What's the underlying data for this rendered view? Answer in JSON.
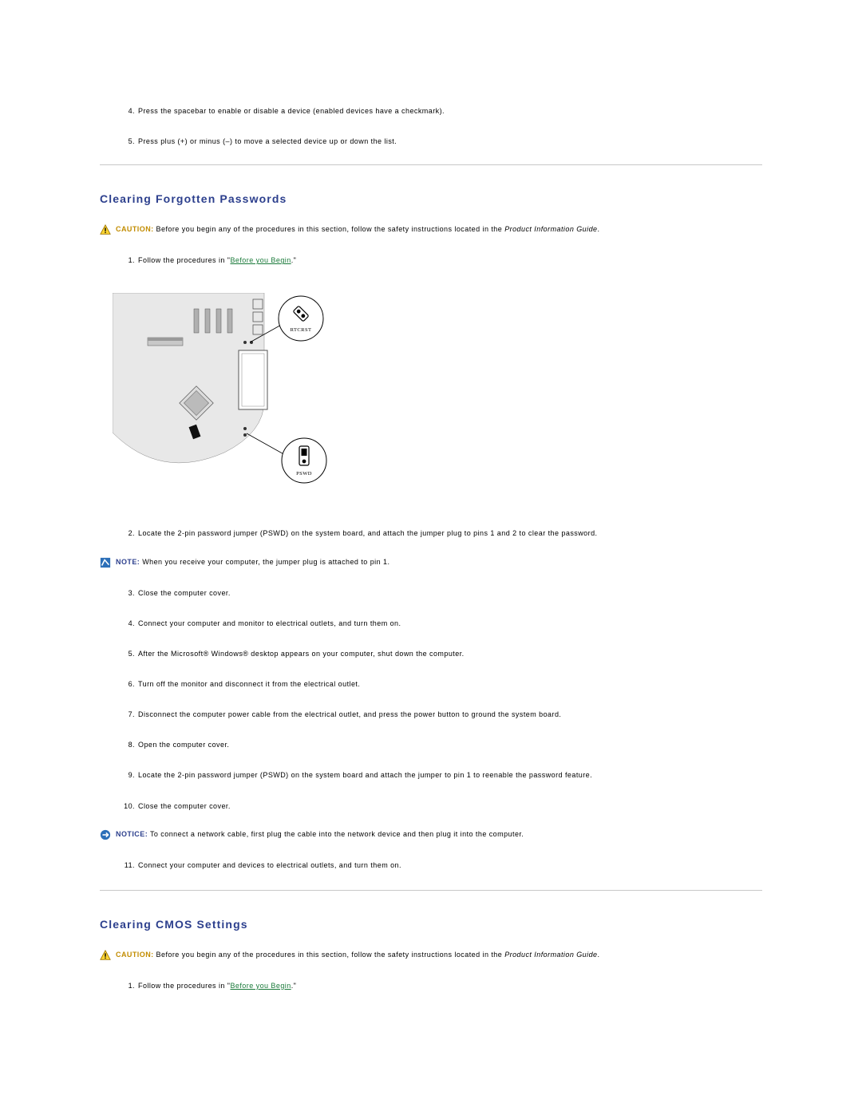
{
  "top_steps": [
    {
      "n": "4.",
      "t": "Press the spacebar to enable or disable a device (enabled devices have a checkmark)."
    },
    {
      "n": "5.",
      "t": "Press plus (+) or minus (–) to move a selected device up or down the list."
    }
  ],
  "section1": {
    "heading": "Clearing Forgotten Passwords",
    "caution_label": "CAUTION:",
    "caution_text_a": "Before you begin any of the procedures in this section, follow the safety instructions located in the ",
    "caution_text_b": "Product Information Guide",
    "caution_text_c": ".",
    "step1_pre": "Follow the procedures in \"",
    "step1_link": "Before you Begin",
    "step1_post": ".\"",
    "diagram": {
      "label_rtcrst": "RTCRST",
      "label_pswd": "PSWD"
    },
    "step2": "Locate the 2-pin password jumper (PSWD) on the system board, and attach the jumper plug to pins 1 and 2 to clear the password.",
    "note_label": "NOTE:",
    "note_text": "When you receive your computer, the jumper plug is attached to pin 1.",
    "steps_3_11": [
      {
        "n": "3.",
        "t": "Close the computer cover."
      },
      {
        "n": "4.",
        "t": "Connect your computer and monitor to electrical outlets, and turn them on."
      },
      {
        "n": "5.",
        "t": "After the Microsoft® Windows® desktop appears on your computer, shut down the computer."
      },
      {
        "n": "6.",
        "t": "Turn off the monitor and disconnect it from the electrical outlet."
      },
      {
        "n": "7.",
        "t": "Disconnect the computer power cable from the electrical outlet, and press the power button to ground the system board."
      },
      {
        "n": "8.",
        "t": "Open the computer cover."
      },
      {
        "n": "9.",
        "t": "Locate the 2-pin password jumper (PSWD) on the system board and attach the jumper to pin 1 to reenable the password feature."
      },
      {
        "n": "10.",
        "t": "Close the computer cover."
      }
    ],
    "notice_label": "NOTICE:",
    "notice_text": "To connect a network cable, first plug the cable into the network device and then plug it into the computer.",
    "step11_n": "11.",
    "step11_t": "Connect your computer and devices to electrical outlets, and turn them on."
  },
  "section2": {
    "heading": "Clearing CMOS Settings",
    "caution_label": "CAUTION:",
    "caution_text_a": "Before you begin any of the procedures in this section, follow the safety instructions located in the ",
    "caution_text_b": "Product Information Guide",
    "caution_text_c": ".",
    "step1_pre": "Follow the procedures in \"",
    "step1_link": "Before you Begin",
    "step1_post": ".\""
  }
}
